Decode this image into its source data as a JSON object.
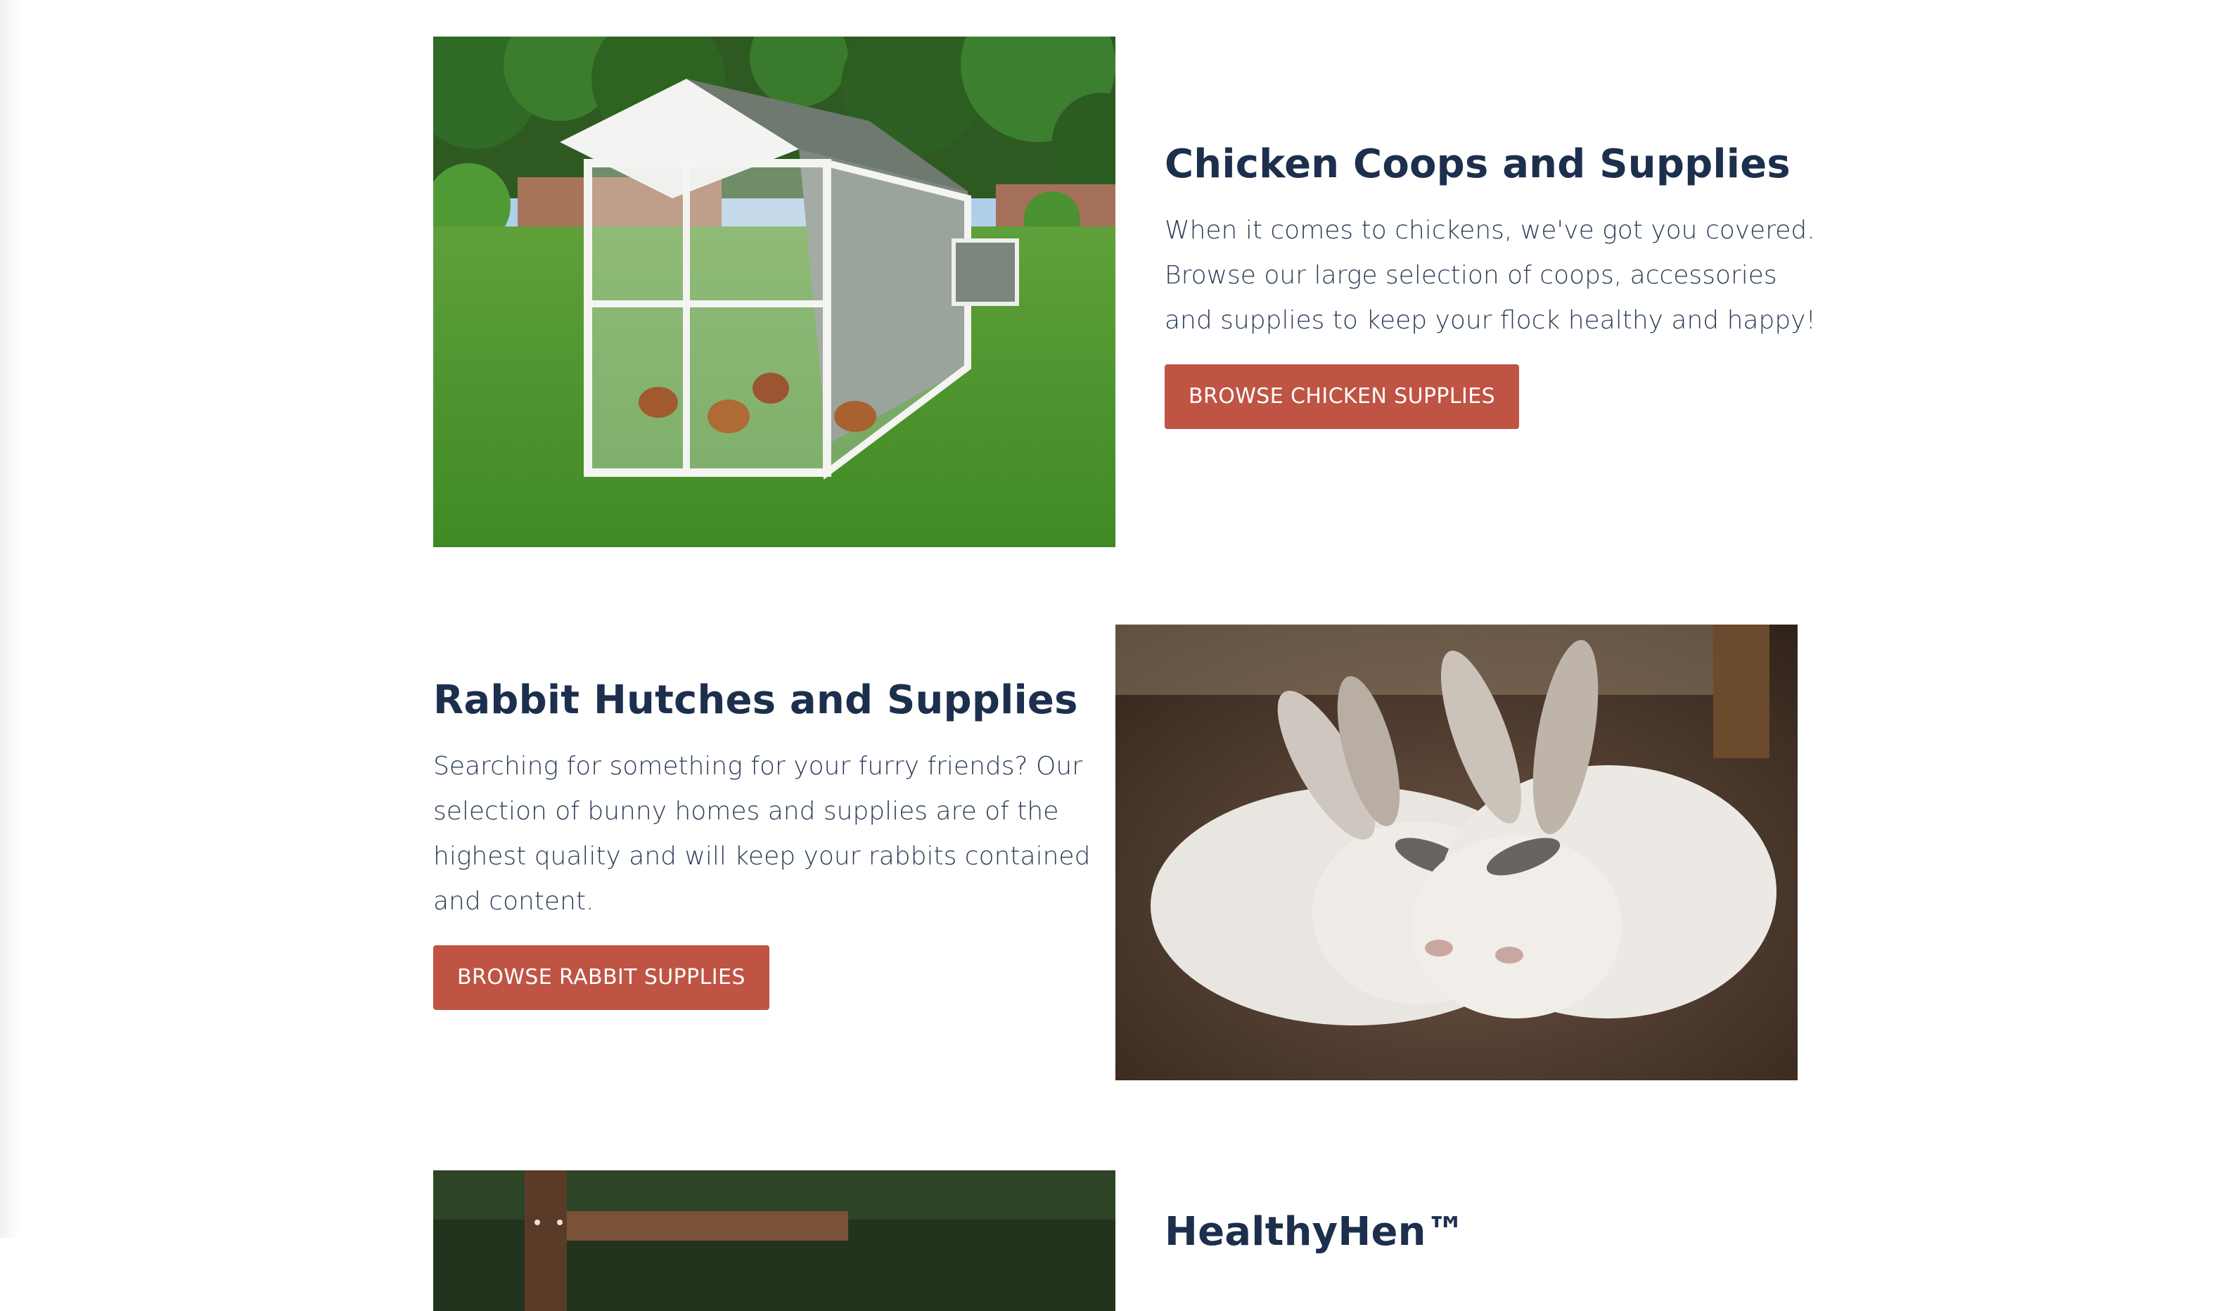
{
  "sections": [
    {
      "heading": "Chicken Coops and Supplies",
      "description": "When it comes to chickens, we've got you covered. Browse our large selection of coops, accessories and supplies to keep your flock healthy and happy!",
      "button_label": "BROWSE CHICKEN SUPPLIES",
      "image_subject": "chicken-coop-photo"
    },
    {
      "heading": "Rabbit Hutches and Supplies",
      "description": "Searching for something for your furry friends? Our selection of bunny homes and supplies are of the highest quality and will keep your rabbits contained and content.",
      "button_label": "BROWSE RABBIT SUPPLIES",
      "image_subject": "rabbits-photo"
    },
    {
      "heading": "HealthyHen™",
      "image_subject": "healthyhen-photo"
    }
  ],
  "colors": {
    "heading": "#1c2f4d",
    "body_text": "#2c3e58",
    "button_background": "#bf5444",
    "button_text": "#ffffff"
  }
}
